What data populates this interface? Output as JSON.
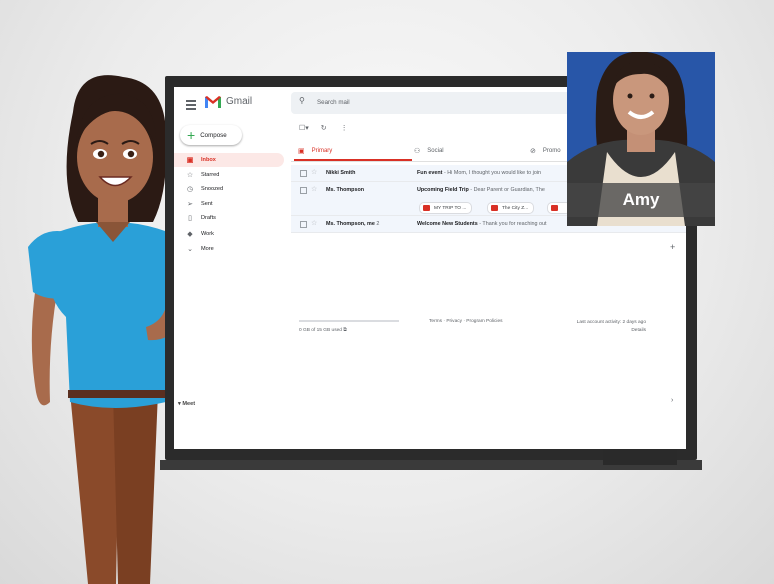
{
  "gmail": {
    "brand": "Gmail",
    "search_placeholder": "Search mail",
    "compose_label": "Compose",
    "nav": [
      {
        "label": "Inbox",
        "icon": "inbox-icon"
      },
      {
        "label": "Starred",
        "icon": "star-icon"
      },
      {
        "label": "Snoozed",
        "icon": "clock-icon"
      },
      {
        "label": "Sent",
        "icon": "send-icon"
      },
      {
        "label": "Drafts",
        "icon": "draft-icon"
      },
      {
        "label": "Work",
        "icon": "label-icon"
      },
      {
        "label": "More",
        "icon": "chevron-down-icon"
      }
    ],
    "meet_label": "Meet",
    "tabs": [
      {
        "label": "Primary",
        "icon": "inbox-icon"
      },
      {
        "label": "Social",
        "icon": "people-icon"
      },
      {
        "label": "Promo",
        "icon": "tag-icon"
      }
    ],
    "emails": [
      {
        "sender": "Nikki Smith",
        "subject": "Fun event",
        "snippet": " - Hi Mom, I thought you would like to join"
      },
      {
        "sender": "Ms. Thompson",
        "subject": "Upcoming Field Trip",
        "snippet": " - Dear Parent or Guardian, The"
      },
      {
        "sender": "Ms. Thompson, me",
        "count": "2",
        "subject": "Welcome New Students",
        "snippet": " - Thank you for reaching out"
      }
    ],
    "attachments": [
      "MY TRIP TO ...",
      "The City Z...",
      ""
    ],
    "storage": "0 GB of 15 GB used",
    "footer_links": "Terms · Privacy · Program Policies",
    "last_activity": "Last account activity: 2 days ago",
    "details": "Details"
  },
  "presenter": {
    "name": "Amy"
  },
  "colors": {
    "accent": "#d93025",
    "video_bg": "#2856a8",
    "compose_plus": "#34a853"
  }
}
